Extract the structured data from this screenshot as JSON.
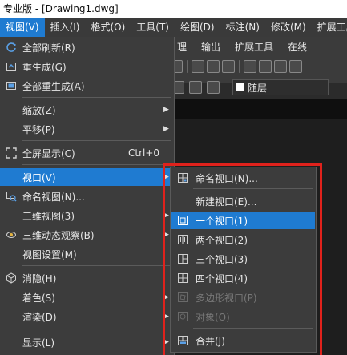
{
  "window": {
    "title": "专业版 - [Drawing1.dwg]"
  },
  "menubar": {
    "items": [
      {
        "label": "视图(V)",
        "active": true
      },
      {
        "label": "插入(I)"
      },
      {
        "label": "格式(O)"
      },
      {
        "label": "工具(T)"
      },
      {
        "label": "绘图(D)"
      },
      {
        "label": "标注(N)"
      },
      {
        "label": "修改(M)"
      },
      {
        "label": "扩展工具"
      }
    ]
  },
  "ribbon": {
    "tabs": [
      "理",
      "输出",
      "扩展工具",
      "在线"
    ],
    "layer_label": "随层"
  },
  "view_menu": {
    "items": [
      {
        "label": "全部刷新(R)",
        "icon": "refresh-icon"
      },
      {
        "label": "重生成(G)",
        "icon": "regen-icon"
      },
      {
        "label": "全部重生成(A)",
        "icon": "regen-all-icon"
      },
      {
        "label": "缩放(Z)",
        "submenu": true
      },
      {
        "label": "平移(P)",
        "submenu": true
      },
      {
        "label": "全屏显示(C)",
        "shortcut": "Ctrl+0",
        "icon": "fullscreen-icon"
      },
      {
        "label": "视口(V)",
        "submenu": true,
        "highlighted": true
      },
      {
        "label": "命名视图(N)...",
        "icon": "named-view-icon"
      },
      {
        "label": "三维视图(3)",
        "submenu": true
      },
      {
        "label": "三维动态观察(B)",
        "submenu": true,
        "icon": "orbit-icon"
      },
      {
        "label": "视图设置(M)"
      },
      {
        "label": "消隐(H)",
        "icon": "hide-icon"
      },
      {
        "label": "着色(S)",
        "submenu": true
      },
      {
        "label": "渲染(D)",
        "submenu": true
      },
      {
        "label": "显示(L)",
        "submenu": true
      }
    ]
  },
  "viewport_submenu": {
    "items": [
      {
        "label": "命名视口(N)...",
        "icon": "named-viewport-icon"
      },
      {
        "label": "新建视口(E)..."
      },
      {
        "label": "一个视口(1)",
        "icon": "one-viewport-icon",
        "highlighted": true
      },
      {
        "label": "两个视口(2)",
        "icon": "two-viewports-icon"
      },
      {
        "label": "三个视口(3)",
        "icon": "three-viewports-icon"
      },
      {
        "label": "四个视口(4)",
        "icon": "four-viewports-icon"
      },
      {
        "label": "多边形视口(P)",
        "icon": "polygon-viewport-icon",
        "disabled": true
      },
      {
        "label": "对象(O)",
        "icon": "object-viewport-icon",
        "disabled": true
      },
      {
        "label": "合并(J)",
        "icon": "join-viewport-icon"
      }
    ]
  },
  "colors": {
    "highlight": "#1f7bd1",
    "menu_bg": "#3c3c3c",
    "frame_red": "#e0221c"
  }
}
